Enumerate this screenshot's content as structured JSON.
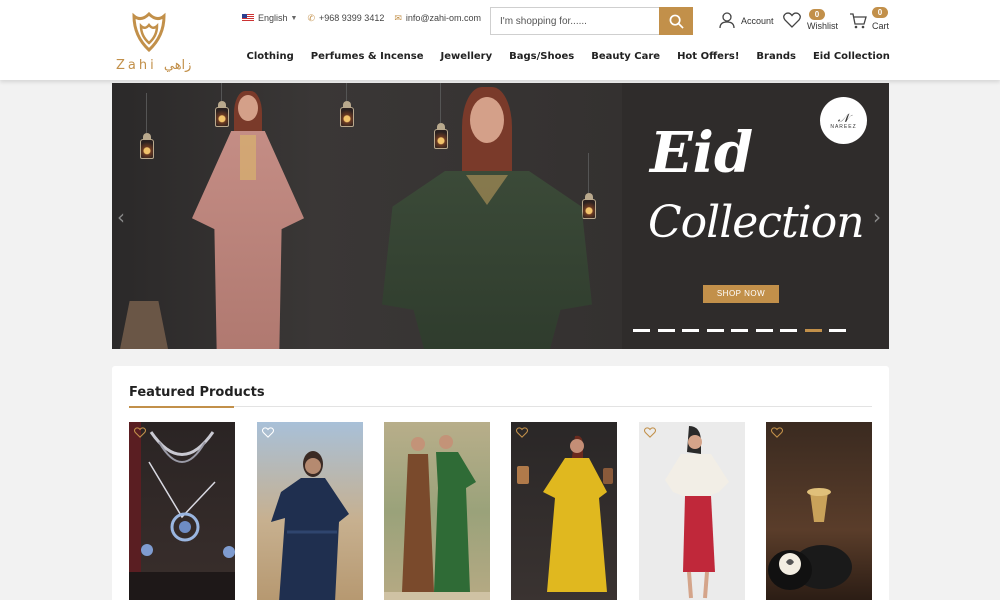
{
  "header": {
    "logo_text": "Zahi زاهي",
    "language": "English",
    "phone": "+968 9399 3412",
    "email": "info@zahi-om.com",
    "search_placeholder": "I'm shopping for......",
    "account_label": "Account",
    "wishlist_label": "Wishlist",
    "wishlist_count": "0",
    "cart_label": "Cart",
    "cart_count": "0"
  },
  "nav": {
    "items": [
      "Clothing",
      "Perfumes & Incense",
      "Jewellery",
      "Bags/Shoes",
      "Beauty Care",
      "Hot Offers!",
      "Brands",
      "Eid Collection"
    ]
  },
  "hero": {
    "title": "Eid",
    "subtitle": "Collection",
    "button": "SHOP NOW",
    "brand_badge": "NAREEZ",
    "slide_count": 9,
    "active_slide": 8
  },
  "featured": {
    "title": "Featured Products"
  },
  "colors": {
    "accent": "#c2904a",
    "header_bg": "#ffffff",
    "page_bg": "#f2f2f2",
    "hero_bg": "#2f2c2b"
  },
  "icons": [
    "phone-icon",
    "mail-icon",
    "search-icon",
    "user-icon",
    "heart-icon",
    "cart-icon",
    "chevron-left-icon",
    "chevron-right-icon"
  ]
}
